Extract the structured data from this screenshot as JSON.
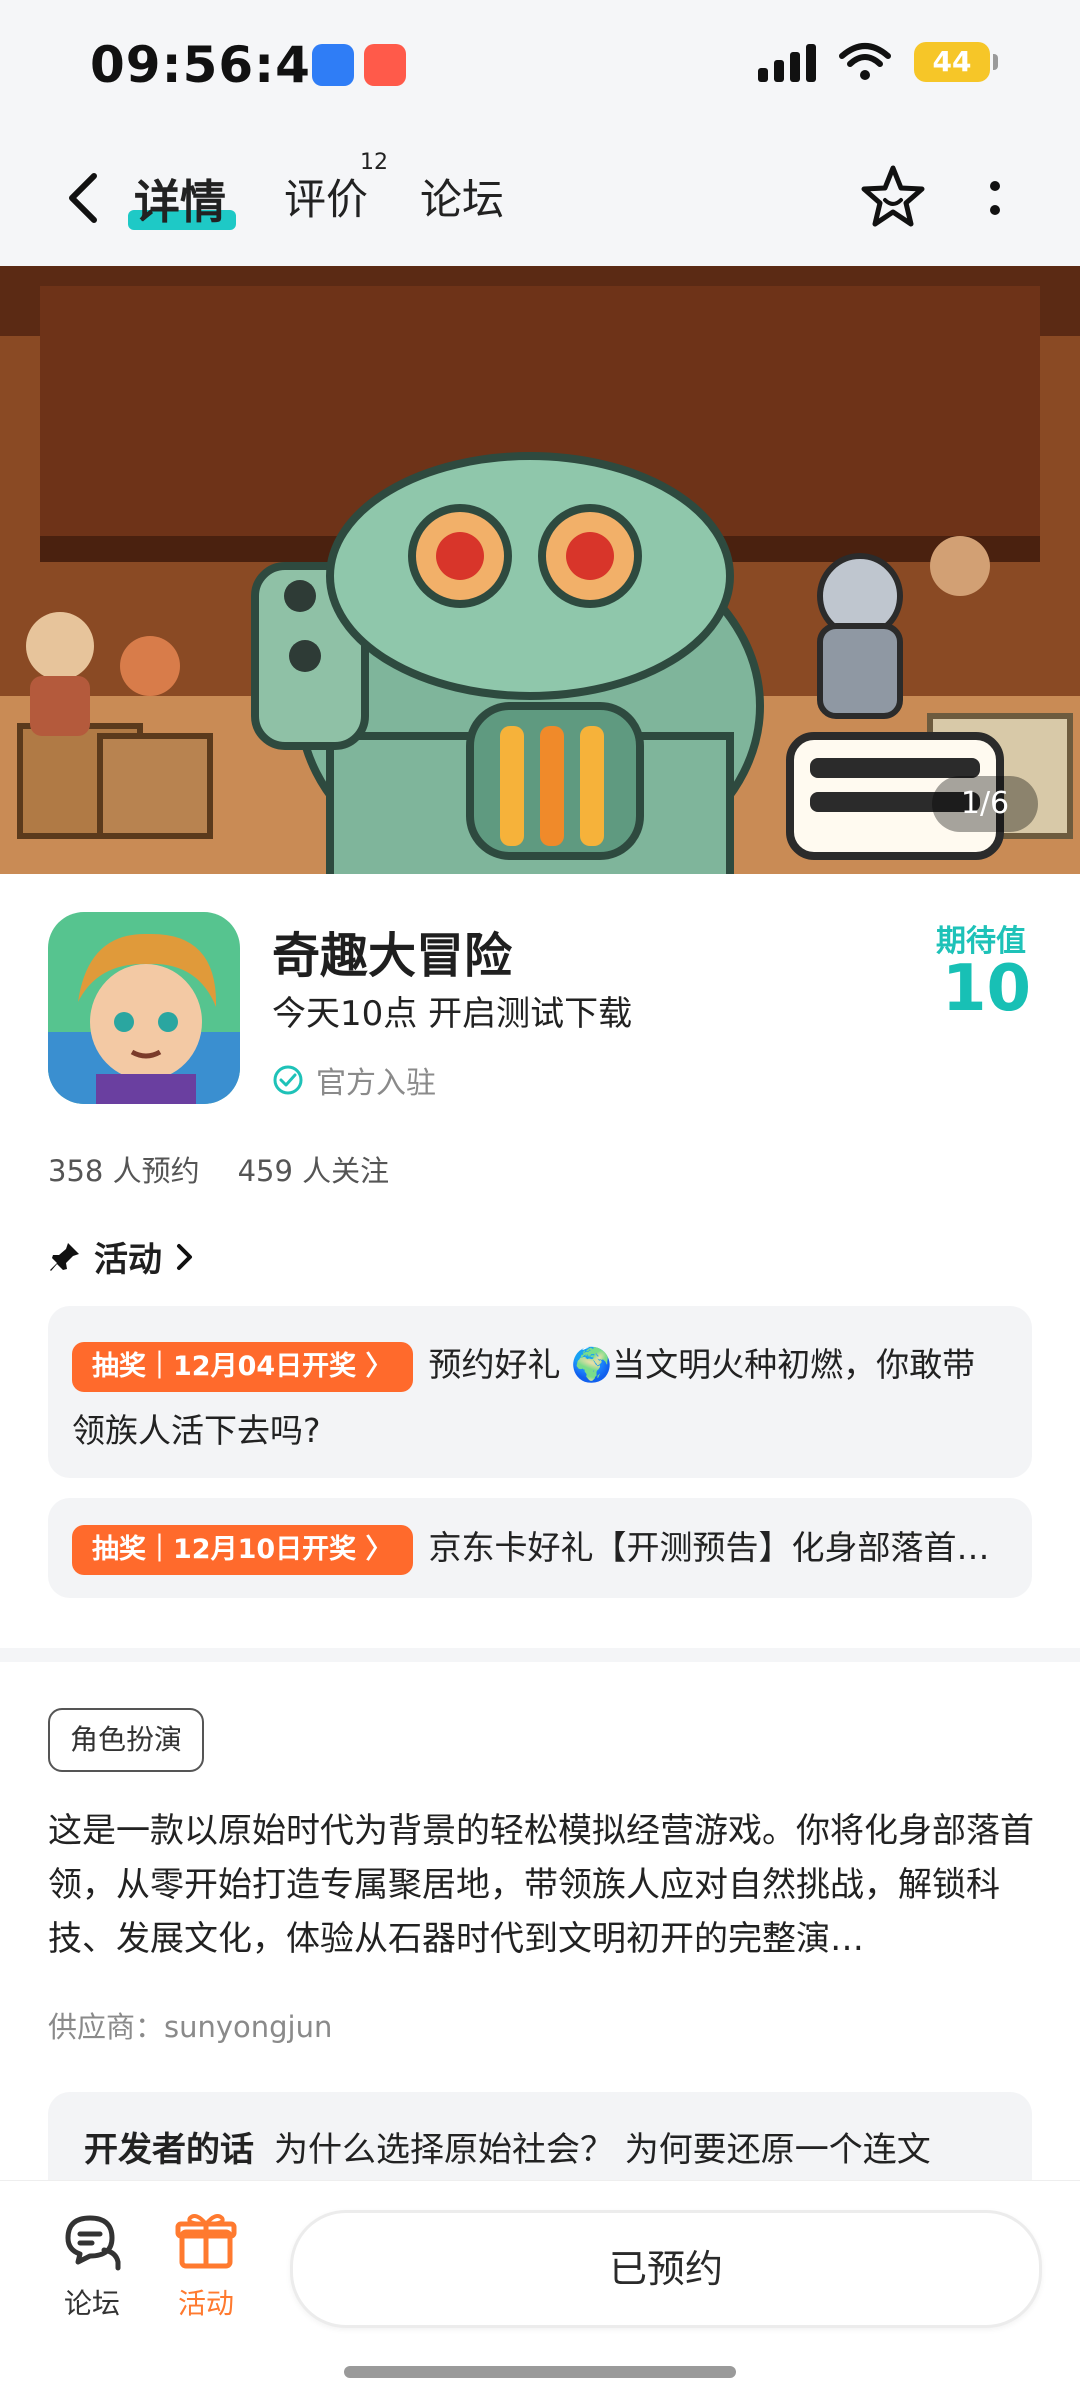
{
  "status_bar": {
    "time": "09:56:42",
    "battery": "44"
  },
  "nav": {
    "tabs": [
      {
        "label": "详情",
        "active": true
      },
      {
        "label": "评价",
        "count": "12"
      },
      {
        "label": "论坛"
      }
    ],
    "back_icon": "back-arrow-icon",
    "favorite_icon": "star-icon",
    "more_icon": "more-icon"
  },
  "hero": {
    "pager": "1/6"
  },
  "game": {
    "name": "奇趣大冒险",
    "subtitle": "今天10点 开启测试下载",
    "official": "官方入驻",
    "expect_label": "期待值",
    "expect_value": "10"
  },
  "stats": {
    "reservations": "358 人预约",
    "followers": "459 人关注"
  },
  "activity": {
    "title": "活动",
    "items": [
      {
        "chip": "抽奖｜12月04日开奖 〉",
        "text": "预约好礼 🌍当文明火种初燃，你敢带领族人活下去吗?"
      },
      {
        "chip": "抽奖｜12月10日开奖 〉",
        "text": "京东卡好礼【开测预告】化身部落首领，从零开始打造专属聚居地"
      }
    ]
  },
  "details": {
    "tag": "角色扮演",
    "description": "这是一款以原始时代为背景的轻松模拟经营游戏。你将化身部落首领，从零开始打造专属聚居地，带领族人应对自然挑战，解锁科技、发展文化，体验从石器时代到文明初开的完整演…",
    "supplier": "供应商：sunyongjun"
  },
  "developer": {
    "title": "开发者的话",
    "text": "为什么选择原始社会？ 为何要还原一个连文"
  },
  "bottom": {
    "forum": "论坛",
    "activity": "活动",
    "reserved": "已预约"
  },
  "colors": {
    "accent_teal": "#1ec2b8",
    "accent_orange": "#ff6a2c"
  }
}
